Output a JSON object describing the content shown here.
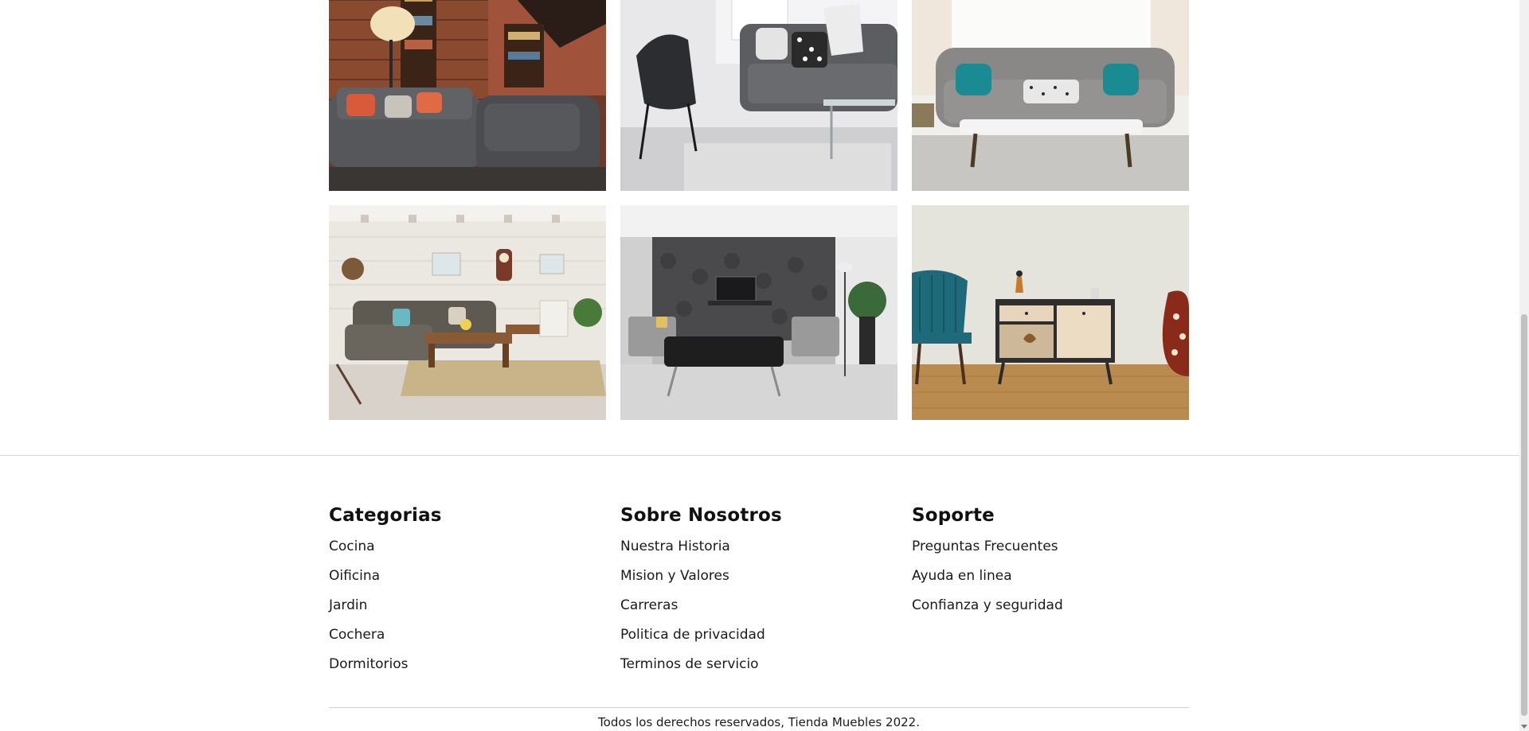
{
  "gallery": {
    "images": [
      {
        "alt": "sala-ladrillo"
      },
      {
        "alt": "sala-gris"
      },
      {
        "alt": "sofa-turquesa"
      },
      {
        "alt": "sala-rustica"
      },
      {
        "alt": "sala-moderna"
      },
      {
        "alt": "mueble-tv"
      }
    ]
  },
  "footer": {
    "columns": [
      {
        "heading": "Categorias",
        "links": [
          "Cocina",
          "Oificina",
          "Jardin",
          "Cochera",
          "Dormitorios"
        ]
      },
      {
        "heading": "Sobre Nosotros",
        "links": [
          "Nuestra Historia",
          "Mision y Valores",
          "Carreras",
          "Politica de privacidad",
          "Terminos de servicio"
        ]
      },
      {
        "heading": "Soporte",
        "links": [
          "Preguntas Frecuentes",
          "Ayuda en linea",
          "Confianza y seguridad"
        ]
      }
    ],
    "copyright": "Todos los derechos reservados, Tienda Muebles 2022."
  },
  "colors": {
    "background": "#ffffff",
    "text": "#1a1a1a",
    "divider": "#dcdcdc"
  }
}
